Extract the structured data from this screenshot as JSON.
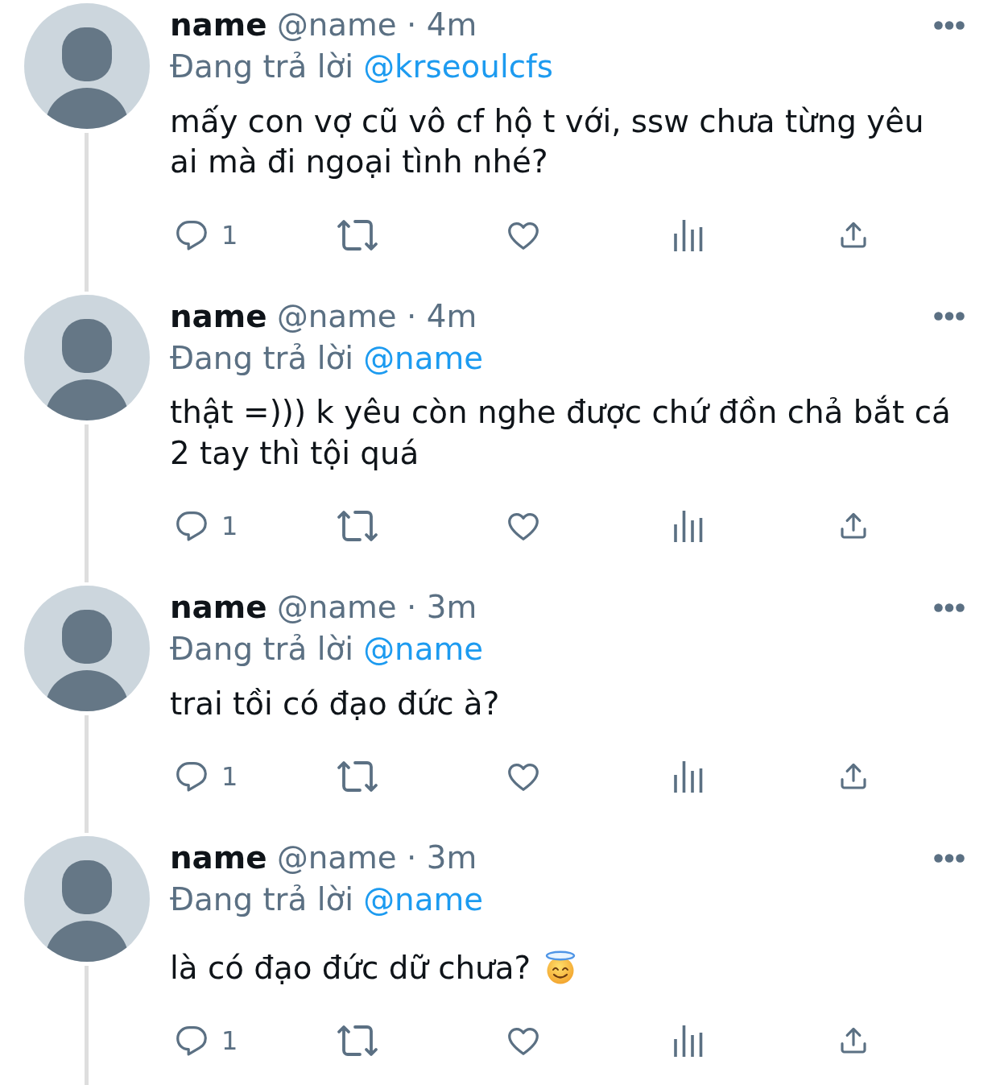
{
  "tweets": [
    {
      "author": "name",
      "meta": "@name · 4m",
      "replying_label": "Đang trả lời",
      "replying_to": "@krseoulcfs",
      "text": "mấy con vợ cũ vô cf hộ t với, ssw chưa từng yêu ai mà đi ngoại tình nhé?",
      "actions": [
        {
          "kind": "reply",
          "count": "1"
        },
        {
          "kind": "repost"
        },
        {
          "kind": "like"
        },
        {
          "kind": "views"
        },
        {
          "kind": "share"
        }
      ]
    },
    {
      "author": "name",
      "meta": "@name · 4m",
      "replying_label": "Đang trả lời",
      "replying_to": "@name",
      "text": "thật =))) k yêu còn nghe được chứ đồn chả bắt cá 2 tay thì tội quá",
      "actions": [
        {
          "kind": "reply",
          "count": "1"
        },
        {
          "kind": "repost"
        },
        {
          "kind": "like"
        },
        {
          "kind": "views"
        },
        {
          "kind": "share"
        }
      ]
    },
    {
      "author": "name",
      "meta": "@name · 3m",
      "replying_label": "Đang trả lời",
      "replying_to": "@name",
      "text": "trai tồi có đạo đức à?",
      "actions": [
        {
          "kind": "reply",
          "count": "1"
        },
        {
          "kind": "repost"
        },
        {
          "kind": "like"
        },
        {
          "kind": "views"
        },
        {
          "kind": "share"
        }
      ]
    },
    {
      "author": "name",
      "meta": "@name · 3m",
      "replying_label": "Đang trả lời",
      "replying_to": "@name",
      "text": "là có đạo đức dữ chưa?",
      "emoji": true,
      "actions": [
        {
          "kind": "reply",
          "count": "1"
        },
        {
          "kind": "repost"
        },
        {
          "kind": "like"
        },
        {
          "kind": "views"
        },
        {
          "kind": "share"
        }
      ]
    }
  ]
}
